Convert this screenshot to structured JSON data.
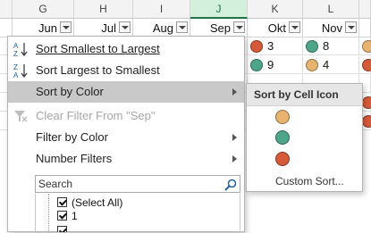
{
  "colors": {
    "orange": "#e8b36f",
    "green": "#4fa58a",
    "red": "#d55a3a",
    "selected_accent": "#217346"
  },
  "columns": [
    {
      "letter": "",
      "header": ""
    },
    {
      "letter": "G",
      "header": "Jun"
    },
    {
      "letter": "H",
      "header": "Jul"
    },
    {
      "letter": "I",
      "header": "Aug"
    },
    {
      "letter": "J",
      "header": "Sep"
    },
    {
      "letter": "K",
      "header": "Okt"
    },
    {
      "letter": "L",
      "header": "Nov"
    },
    {
      "letter": "",
      "header": ""
    }
  ],
  "rows": [
    {
      "K": {
        "icon": "red",
        "value": "3"
      },
      "L": {
        "icon": "green",
        "value": "8"
      },
      "M": {
        "icon": "orange"
      }
    },
    {
      "K": {
        "icon": "green",
        "value": "9"
      },
      "L": {
        "icon": "orange",
        "value": "4"
      },
      "M": {
        "icon": "red"
      }
    },
    {
      "K": {
        "icon": "",
        "value": ""
      },
      "L": {
        "icon": "",
        "value": ""
      },
      "M": {
        "icon": ""
      }
    },
    {
      "K": {
        "icon": "",
        "value": ""
      },
      "L": {
        "icon": "",
        "value": ""
      },
      "M": {
        "icon": "red"
      }
    },
    {
      "K": {
        "icon": "",
        "value": ""
      },
      "L": {
        "icon": "",
        "value": ""
      },
      "M": {
        "icon": "red"
      }
    }
  ],
  "menu": {
    "sort_asc": "Sort Smallest to Largest",
    "sort_desc": "Sort Largest to Smallest",
    "sort_by_color": "Sort by Color",
    "clear_filter": "Clear Filter From \"Sep\"",
    "filter_by_color": "Filter by Color",
    "number_filters": "Number Filters",
    "search_placeholder": "Search",
    "list_items": [
      {
        "label": "(Select All)",
        "checked": true
      },
      {
        "label": "1",
        "checked": true
      }
    ]
  },
  "submenu": {
    "title": "Sort by Cell Icon",
    "icons": [
      "orange",
      "green",
      "red"
    ],
    "custom_sort": "Custom Sort..."
  }
}
